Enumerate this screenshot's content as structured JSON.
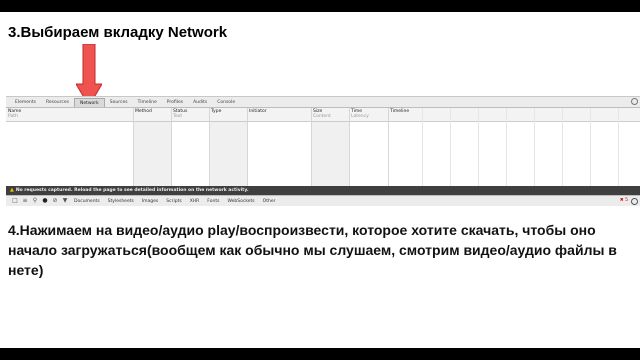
{
  "slide": {
    "step_title": "3.Выбираем вкладку Network",
    "step_desc": "4.Нажимаем на видео/аудио play/воспроизвести, которое хотите скачать, чтобы оно начало загружаться(вообщем как обычно мы слушаем, смотрим видео/аудио файлы в нете)",
    "arrow_color": "#e53935"
  },
  "devtools": {
    "tabs": [
      "Elements",
      "Resources",
      "Network",
      "Sources",
      "Timeline",
      "Profiles",
      "Audits",
      "Console"
    ],
    "active_tab": "Network",
    "columns": [
      {
        "label": "Name",
        "sub": "Path"
      },
      {
        "label": "Method",
        "sub": ""
      },
      {
        "label": "Status",
        "sub": "Text"
      },
      {
        "label": "Type",
        "sub": ""
      },
      {
        "label": "Initiator",
        "sub": ""
      },
      {
        "label": "Size",
        "sub": "Content"
      },
      {
        "label": "Time",
        "sub": "Latency"
      },
      {
        "label": "Timeline",
        "sub": ""
      }
    ],
    "status_message": "No requests captured. Reload the page to see detailed information on the network activity.",
    "filters": [
      "Documents",
      "Stylesheets",
      "Images",
      "Scripts",
      "XHR",
      "Fonts",
      "WebSockets",
      "Other"
    ],
    "error_count": "5"
  }
}
